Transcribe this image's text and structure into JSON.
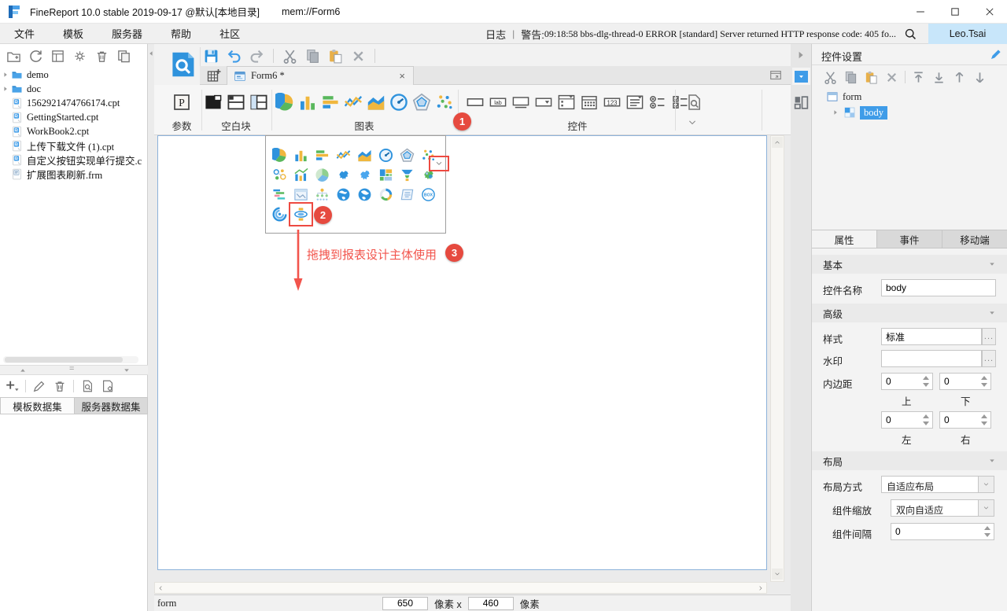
{
  "window": {
    "title": "FineReport 10.0 stable 2019-09-17 @默认[本地目录]",
    "document": "mem://Form6"
  },
  "menu_bar": {
    "items": [
      "文件",
      "模板",
      "服务器",
      "帮助",
      "社区"
    ],
    "log_label": "日志",
    "separator": "|",
    "warning_label": "警告:",
    "warning_message": "09:18:58 bbs-dlg-thread-0 ERROR [standard] Server returned HTTP response code: 405 fo...",
    "user_name": "Leo.Tsai"
  },
  "file_panel": {
    "toolbar_icons": [
      "new-folder",
      "refresh",
      "report-view",
      "settings-doc",
      "trash",
      "copy-pages"
    ],
    "tree": [
      {
        "label": "demo",
        "icon": "folder",
        "expandable": true
      },
      {
        "label": "doc",
        "icon": "folder",
        "expandable": true
      },
      {
        "label": "1562921474766174.cpt",
        "icon": "cpt-file"
      },
      {
        "label": "GettingStarted.cpt",
        "icon": "cpt-file"
      },
      {
        "label": "WorkBook2.cpt",
        "icon": "cpt-file"
      },
      {
        "label": "上传下载文件 (1).cpt",
        "icon": "cpt-file"
      },
      {
        "label": "自定义按钮实现单行提交.c",
        "icon": "cpt-file"
      },
      {
        "label": "扩展图表刷新.frm",
        "icon": "frm-file"
      }
    ],
    "dataset_toolbar_icons": [
      "add-plus",
      "edit-pencil",
      "trash",
      "preview-doc",
      "config-doc"
    ],
    "dataset_tabs": [
      {
        "label": "模板数据集",
        "active": true
      },
      {
        "label": "服务器数据集",
        "active": false
      }
    ]
  },
  "toolbar": {
    "quick_icons_left": [
      "save",
      "undo",
      "redo"
    ],
    "quick_icons_right": [
      "cut",
      "copy",
      "paste",
      "delete-x"
    ],
    "tab": {
      "label": "Form6 *",
      "close": "×"
    }
  },
  "ribbon": {
    "groups": [
      {
        "label": "参数",
        "icons": [
          "parameter"
        ]
      },
      {
        "label": "空白块",
        "icons": [
          "block-solid",
          "block-split",
          "block-table"
        ]
      },
      {
        "label": "图表",
        "icons": [
          "pie",
          "column",
          "bar",
          "line",
          "area",
          "gauge",
          "radar",
          "scatter"
        ],
        "dropdown": true
      },
      {
        "label": "控件",
        "icons": [
          "text-field",
          "label-widget",
          "password-field",
          "combobox",
          "view-tree",
          "date-picker",
          "number-field",
          "list-view",
          "radio-group",
          "checkbox-group"
        ],
        "extra_icons": [
          "preview-doc"
        ],
        "dropdown": true
      }
    ]
  },
  "chart_popup": {
    "rows": [
      [
        "pie",
        "column",
        "bar",
        "line",
        "area",
        "gauge",
        "radar",
        "scatter"
      ],
      [
        "bubble",
        "combo",
        "sphere-pie",
        "china-map",
        "china-map-alt",
        "treemap",
        "funnel",
        "colored-map"
      ],
      [
        "gantt",
        "frame-report",
        "org-tree",
        "globe",
        "globe-alt",
        "ring-progress",
        "word-text",
        "box-plot"
      ],
      [
        "spiral",
        "drill-carousel"
      ]
    ],
    "highlighted_icon": "drill-carousel"
  },
  "annotations": {
    "step1": "1",
    "step2": "2",
    "step3": "3",
    "tip_text": "拖拽到报表设计主体使用",
    "color": "#ed4a41"
  },
  "status_bar": {
    "form_label": "form",
    "width_value": "650",
    "width_unit": "像素 x",
    "height_value": "460",
    "height_unit": "像素"
  },
  "widget_panel": {
    "title": "控件设置",
    "toolbar_icons": [
      "cut",
      "copy",
      "paste",
      "delete-x",
      "move-top",
      "move-bottom",
      "move-up",
      "move-down"
    ],
    "tree": {
      "root_label": "form",
      "child_label": "body"
    },
    "tabs": [
      {
        "label": "属性",
        "active": true
      },
      {
        "label": "事件",
        "active": false
      },
      {
        "label": "移动端",
        "active": false
      }
    ],
    "props": {
      "basic_label": "基本",
      "widget_name_label": "控件名称",
      "widget_name_value": "body",
      "advanced_label": "高级",
      "style_label": "样式",
      "style_value": "标准",
      "watermark_label": "水印",
      "watermark_value": "",
      "padding_label": "内边距",
      "padding_top": "0",
      "padding_top_label": "上",
      "padding_bottom": "0",
      "padding_bottom_label": "下",
      "padding_left": "0",
      "padding_left_label": "左",
      "padding_right": "0",
      "padding_right_label": "右",
      "layout_label": "布局",
      "layout_mode_label": "布局方式",
      "layout_mode_value": "自适应布局",
      "scale_label": "组件缩放",
      "scale_value": "双向自适应",
      "gap_label": "组件间隔",
      "gap_value": "0"
    }
  },
  "colors": {
    "accent_blue": "#2f93dd",
    "selection_blue": "#3f9ce8",
    "annotation_red": "#ed4a41",
    "user_chip": "#c8e6fa"
  }
}
